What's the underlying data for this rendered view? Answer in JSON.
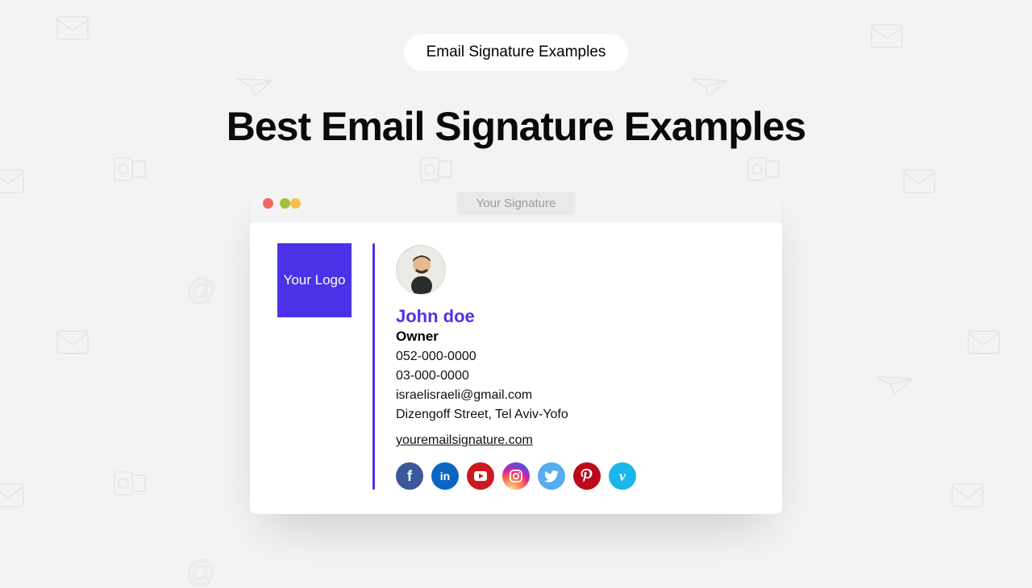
{
  "pill_label": "Email Signature Examples",
  "headline": "Best Email Signature Examples",
  "window": {
    "tab_label": "Your Signature"
  },
  "signature": {
    "logo_text": "Your Logo",
    "name": "John doe",
    "role": "Owner",
    "lines": {
      "mobile": "052-000-0000",
      "phone": "03-000-0000",
      "email": "israelisraeli@gmail.com",
      "address": "Dizengoff Street, Tel Aviv-Yofo"
    },
    "website": "youremailsignature.com"
  },
  "social": {
    "facebook": "f",
    "linkedin": "in",
    "youtube": "▶",
    "instagram": "⌾",
    "twitter": "🐦",
    "pinterest": "P",
    "vimeo": "v"
  }
}
